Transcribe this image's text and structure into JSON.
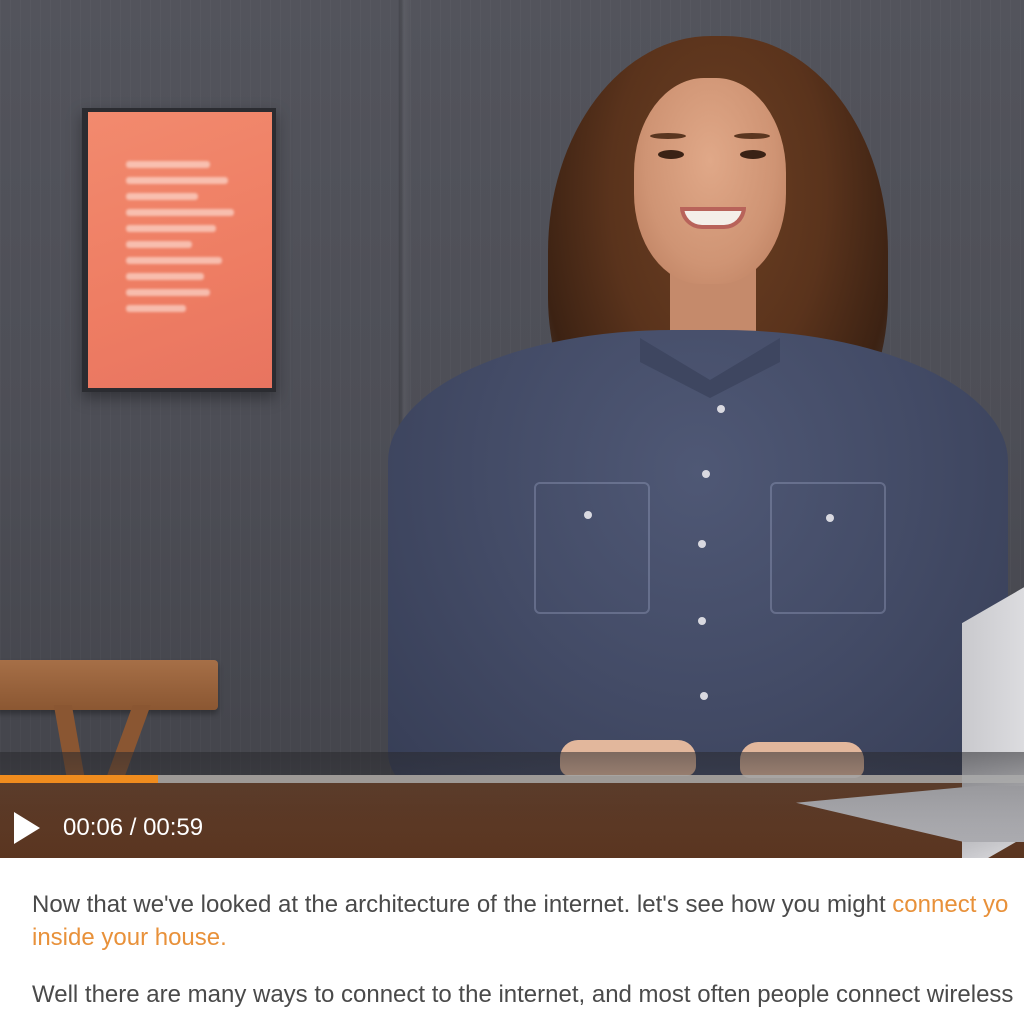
{
  "player": {
    "current_time": "00:06",
    "duration": "00:59",
    "time_display": "00:06 / 00:59",
    "progress": 0.154,
    "accent_color": "#f08c1e",
    "play_icon": "play-icon"
  },
  "transcript": {
    "paragraphs": [
      {
        "text": "Now that we've looked at the architecture of the internet. let's see how you might ",
        "highlight_line1": "connect yo",
        "highlight_line2": "inside your house."
      },
      {
        "text": "Well there are many ways to connect to the internet, and most often people connect wireless"
      }
    ],
    "highlight_color": "#e8913a",
    "text_color": "#4a4a4a"
  }
}
